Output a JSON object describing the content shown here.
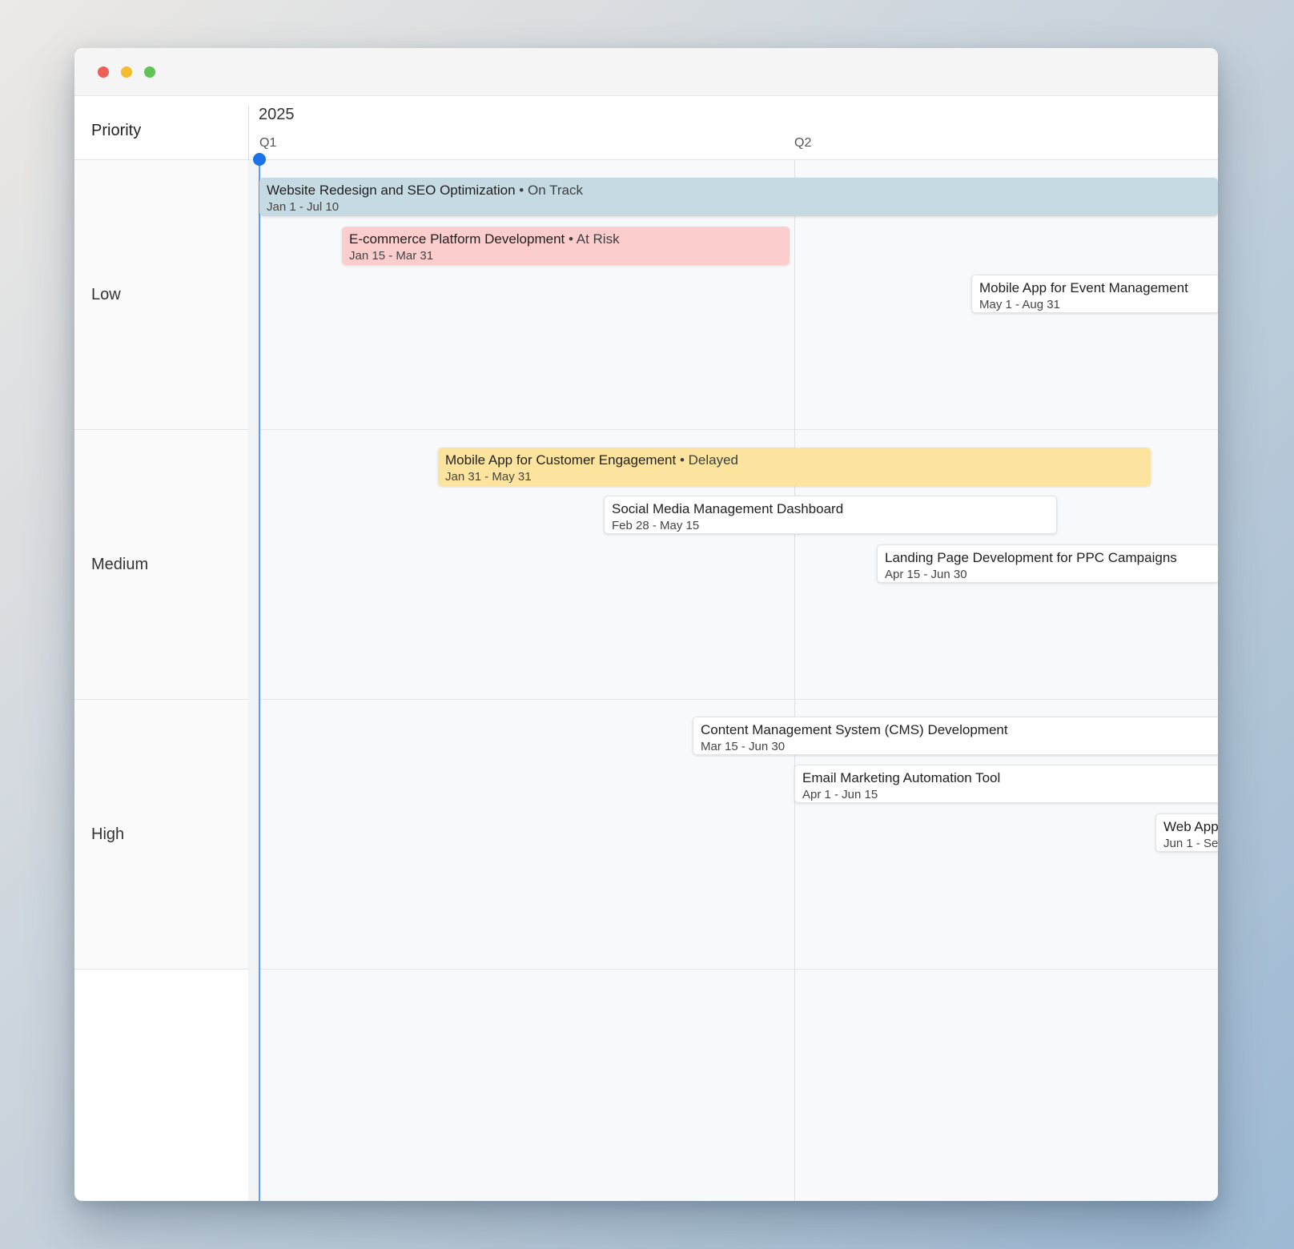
{
  "window": {
    "controls": [
      "close",
      "minimize",
      "maximize"
    ]
  },
  "sidebar": {
    "header": "Priority",
    "rows": [
      {
        "label": "Low"
      },
      {
        "label": "Medium"
      },
      {
        "label": "High"
      },
      {
        "label": ""
      }
    ]
  },
  "timeline": {
    "year": "2025",
    "quarters": [
      {
        "label": "Q1"
      },
      {
        "label": "Q2"
      }
    ]
  },
  "tasks": [
    {
      "name": "Website Redesign and SEO Optimization",
      "status": " • On Track",
      "dates": "Jan 1 - Jul 10",
      "priority": "Low",
      "color": "#c5dae3"
    },
    {
      "name": "E-commerce Platform Development",
      "status": " • At Risk",
      "dates": "Jan 15 - Mar 31",
      "priority": "Low",
      "color": "#fbcdcd"
    },
    {
      "name": "Mobile App for Event Management",
      "status": "",
      "dates": "May 1 - Aug 31",
      "priority": "Low",
      "color": "#ffffff"
    },
    {
      "name": "Mobile App for Customer Engagement",
      "status": " • Delayed",
      "dates": "Jan 31 - May 31",
      "priority": "Medium",
      "color": "#fde49e"
    },
    {
      "name": "Social Media Management Dashboard",
      "status": "",
      "dates": "Feb 28 - May 15",
      "priority": "Medium",
      "color": "#ffffff"
    },
    {
      "name": "Landing Page Development for PPC Campaigns",
      "status": "",
      "dates": "Apr 15 - Jun 30",
      "priority": "Medium",
      "color": "#ffffff"
    },
    {
      "name": "Content Management System (CMS) Development",
      "status": "",
      "dates": "Mar 15 - Jun 30",
      "priority": "High",
      "color": "#ffffff"
    },
    {
      "name": "Email Marketing Automation Tool",
      "status": "",
      "dates": "Apr 1 - Jun 15",
      "priority": "High",
      "color": "#ffffff"
    },
    {
      "name": "Web App",
      "status": "",
      "dates": "Jun 1 - Se",
      "priority": "High",
      "color": "#ffffff"
    }
  ],
  "colors": {
    "today_marker": "#1a73e8",
    "on_track": "#c5dae3",
    "at_risk": "#fbcdcd",
    "delayed": "#fde49e"
  }
}
